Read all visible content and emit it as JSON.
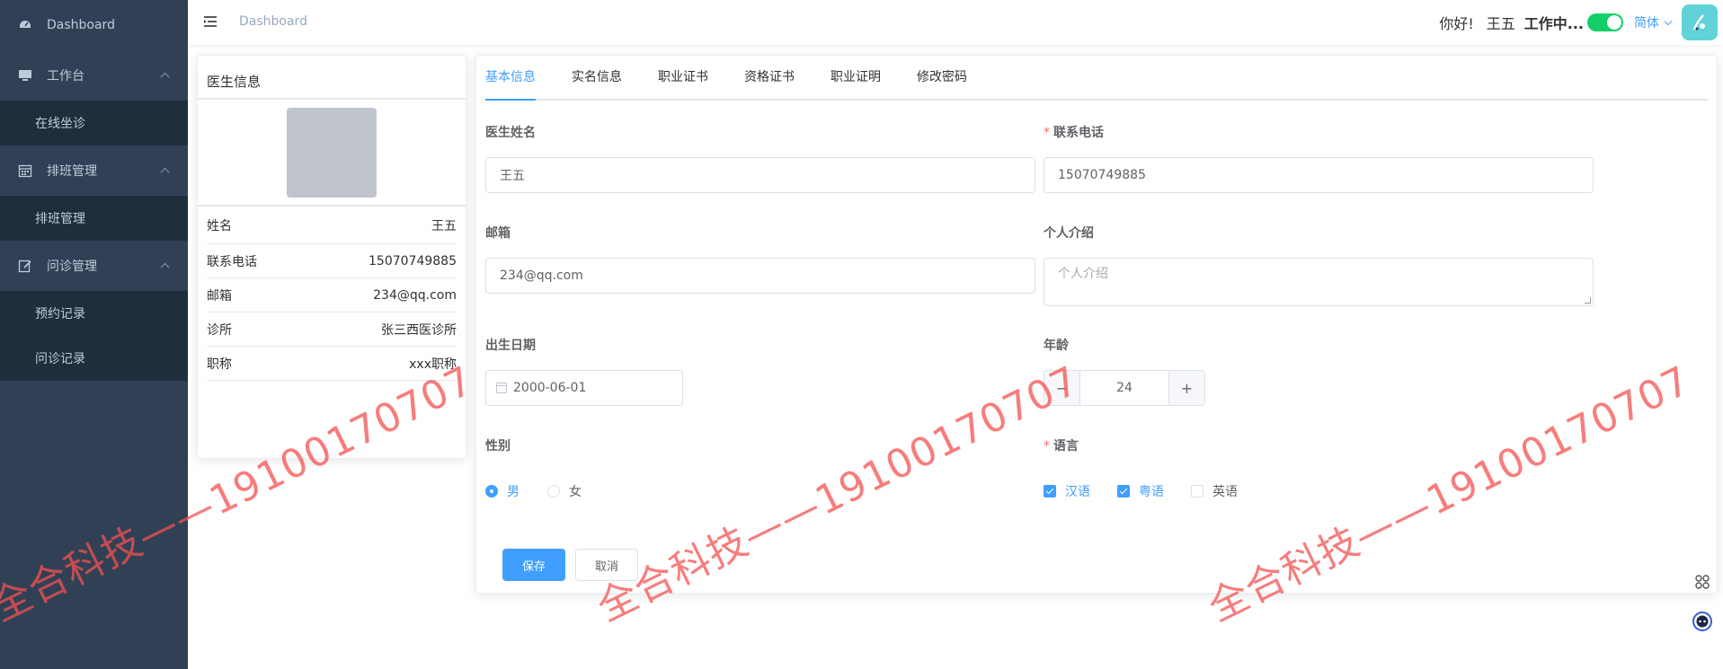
{
  "sidebar": {
    "items": [
      {
        "label": "Dashboard",
        "icon": "dashboard-icon"
      },
      {
        "label": "工作台",
        "icon": "monitor-icon",
        "children": [
          "在线坐诊"
        ]
      },
      {
        "label": "排班管理",
        "icon": "calendar-icon",
        "children": [
          "排班管理"
        ]
      },
      {
        "label": "问诊管理",
        "icon": "edit-icon",
        "children": [
          "预约记录",
          "问诊记录"
        ]
      }
    ]
  },
  "navbar": {
    "breadcrumb": "Dashboard",
    "greeting": "你好!",
    "username": "王五",
    "status": "工作中...",
    "status_on": true,
    "language": "简体"
  },
  "profile": {
    "title": "医生信息",
    "rows": [
      {
        "label": "姓名",
        "value": "王五"
      },
      {
        "label": "联系电话",
        "value": "15070749885"
      },
      {
        "label": "邮箱",
        "value": "234@qq.com"
      },
      {
        "label": "诊所",
        "value": "张三西医诊所"
      },
      {
        "label": "职称",
        "value": "xxx职称"
      }
    ]
  },
  "tabs": [
    "基本信息",
    "实名信息",
    "职业证书",
    "资格证书",
    "职业证明",
    "修改密码"
  ],
  "active_tab": "基本信息",
  "form": {
    "name_label": "医生姓名",
    "name_value": "王五",
    "phone_label": "联系电话",
    "phone_value": "15070749885",
    "email_label": "邮箱",
    "email_value": "234@qq.com",
    "intro_label": "个人介绍",
    "intro_placeholder": "个人介绍",
    "birth_label": "出生日期",
    "birth_value": "2000-06-01",
    "age_label": "年龄",
    "age_value": "24",
    "gender_label": "性别",
    "gender_options": [
      "男",
      "女"
    ],
    "gender_selected": "男",
    "lang_label": "语言",
    "lang_options": [
      {
        "label": "汉语",
        "checked": true
      },
      {
        "label": "粤语",
        "checked": true
      },
      {
        "label": "英语",
        "checked": false
      }
    ],
    "save_label": "保存",
    "cancel_label": "取消"
  },
  "watermark": "全合科技——19100170707",
  "colors": {
    "sidebar_bg": "#304156",
    "submenu_bg": "#1f2d3d",
    "primary": "#409eff",
    "switch_on": "#13ce66",
    "required": "#f56c6c"
  }
}
